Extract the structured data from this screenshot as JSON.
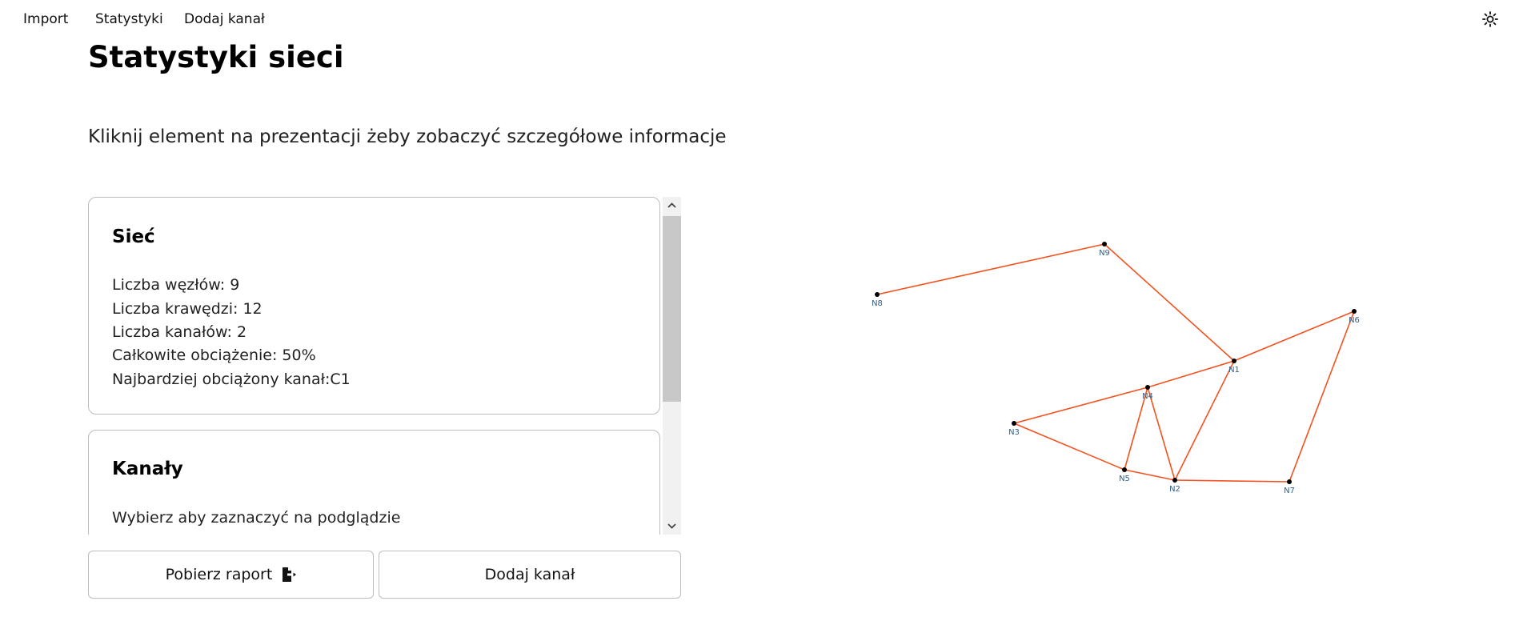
{
  "nav": {
    "items": [
      "Import",
      "Statystyki",
      "Dodaj kanał"
    ],
    "theme_icon": "sun-icon"
  },
  "page": {
    "title": "Statystyki sieci",
    "hint": "Kliknij element na prezentacji żeby zobaczyć szczegółowe informacje"
  },
  "cards": {
    "network": {
      "title": "Sieć",
      "stats": [
        "Liczba węzłów: 9",
        "Liczba krawędzi: 12",
        "Liczba kanałów: 2",
        "Całkowite obciążenie: 50%",
        "Najbardziej obciążony kanał:C1"
      ]
    },
    "channels": {
      "title": "Kanały",
      "hint": "Wybierz aby zaznaczyć na podglądzie"
    }
  },
  "buttons": {
    "report": "Pobierz raport",
    "report_icon": "file-export-icon",
    "add_channel": "Dodaj kanał"
  },
  "graph": {
    "edge_color": "#f4511e",
    "node_color": "#000000",
    "label_color": "#2f5f86",
    "nodes": [
      "N1",
      "N2",
      "N3",
      "N4",
      "N5",
      "N6",
      "N7",
      "N8",
      "N9"
    ],
    "edges": [
      [
        "N8",
        "N9"
      ],
      [
        "N9",
        "N1"
      ],
      [
        "N1",
        "N6"
      ],
      [
        "N1",
        "N4"
      ],
      [
        "N1",
        "N2"
      ],
      [
        "N4",
        "N3"
      ],
      [
        "N4",
        "N5"
      ],
      [
        "N4",
        "N2"
      ],
      [
        "N3",
        "N5"
      ],
      [
        "N5",
        "N2"
      ],
      [
        "N2",
        "N7"
      ],
      [
        "N7",
        "N6"
      ]
    ]
  }
}
